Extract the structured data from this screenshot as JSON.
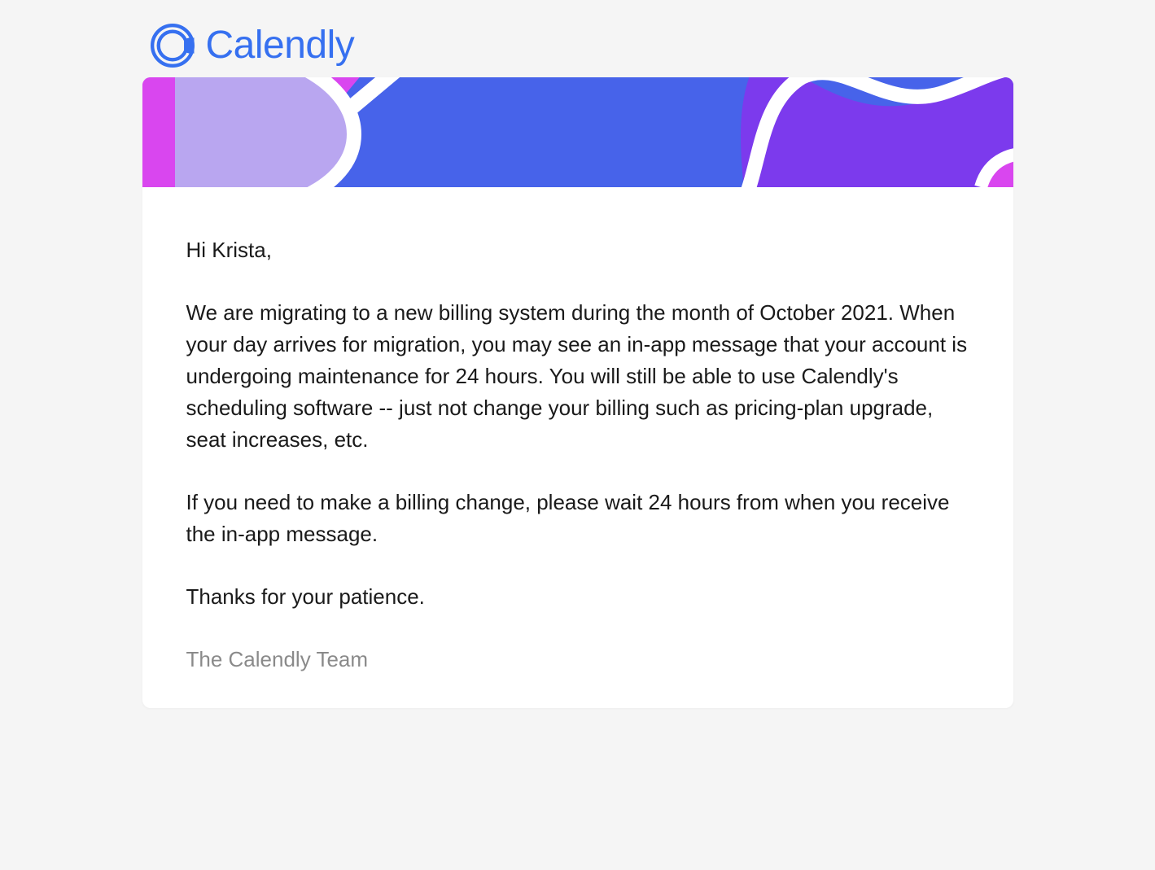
{
  "brand": {
    "name": "Calendly",
    "logoColor": "#3670f0"
  },
  "email": {
    "greeting": "Hi Krista,",
    "paragraph1": "We are migrating to a new billing system during the month of October 2021. When your day arrives for migration, you may see an in-app message that your account is undergoing maintenance for 24 hours. You will still be able to use Calendly's scheduling software -- just not change your billing such as pricing-plan upgrade, seat increases, etc.",
    "paragraph2": "If you need to make a billing change, please wait 24 hours from when you receive the in-app message.",
    "paragraph3": "Thanks for your patience.",
    "signature": "The Calendly Team"
  }
}
